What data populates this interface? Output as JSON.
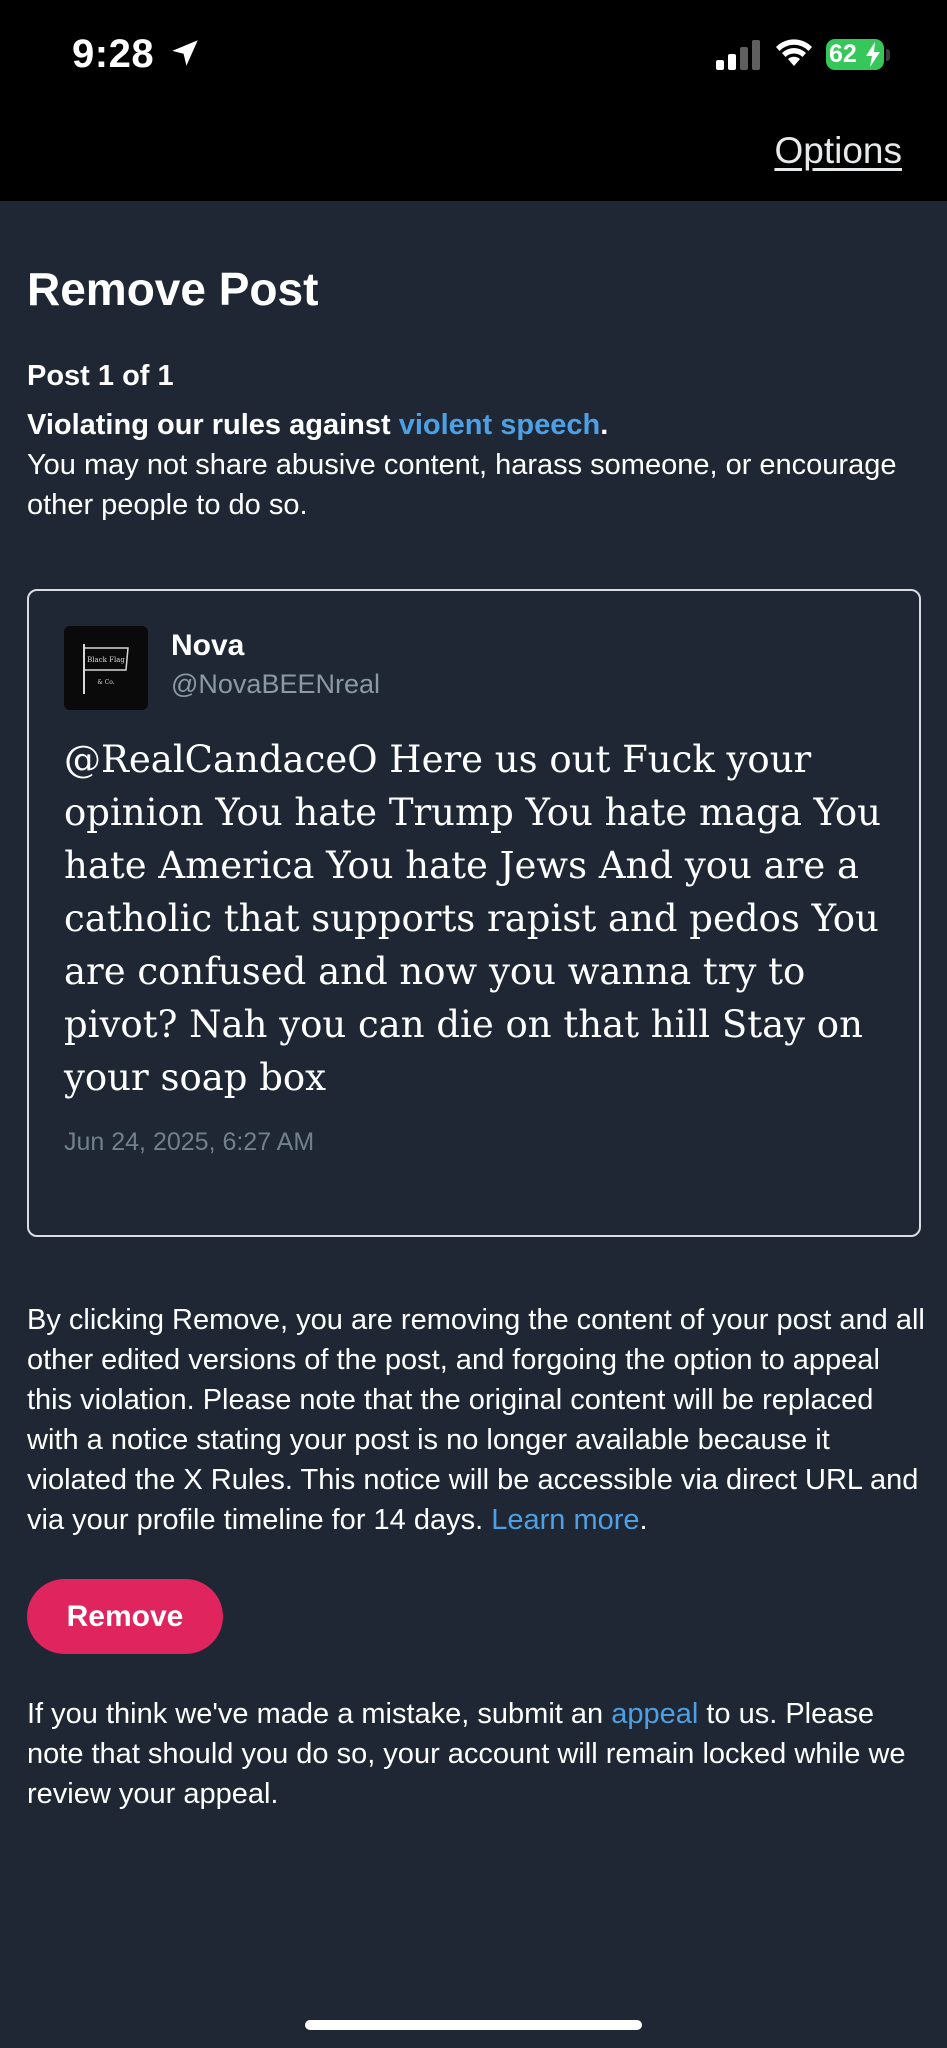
{
  "status_bar": {
    "time": "9:28",
    "battery": "62",
    "battery_color": "#35c759"
  },
  "header": {
    "options_label": "Options"
  },
  "page": {
    "title": "Remove Post",
    "post_count": "Post 1 of 1",
    "violation_prefix": "Violating our rules against ",
    "violation_link": "violent speech",
    "violation_suffix": ".",
    "violation_description": "You may not share abusive content, harass someone, or encourage other people to do so."
  },
  "post": {
    "author_name": "Nova",
    "author_handle": "@NovaBEENreal",
    "avatar_text": "Black Flag & Co.",
    "text": "@RealCandaceO Here us out Fuck your opinion You hate Trump You hate maga You hate America You hate Jews And you are a catholic that supports rapist and pedos You are confused and now you wanna try to pivot? Nah you can die on that hill Stay on your soap box",
    "timestamp": "Jun 24, 2025, 6:27 AM"
  },
  "disclaimer": {
    "text": "By clicking Remove, you are removing the content of your post and all other edited versions of the post, and forgoing the option to appeal this violation. Please note that the original content will be replaced with a notice stating your post is no longer available because it violated the X Rules. This notice will be accessible via direct URL and via your profile timeline for 14 days. ",
    "link": "Learn more",
    "suffix": "."
  },
  "actions": {
    "remove_label": "Remove",
    "remove_color": "#e0245e"
  },
  "appeal": {
    "prefix": "If you think we've made a mistake, submit an ",
    "link": "appeal",
    "suffix": " to us. Please note that should you do so, your account will remain locked while we review your appeal."
  },
  "colors": {
    "background": "#1e2733",
    "link": "#4ea0e5",
    "muted": "#8b98a5"
  }
}
